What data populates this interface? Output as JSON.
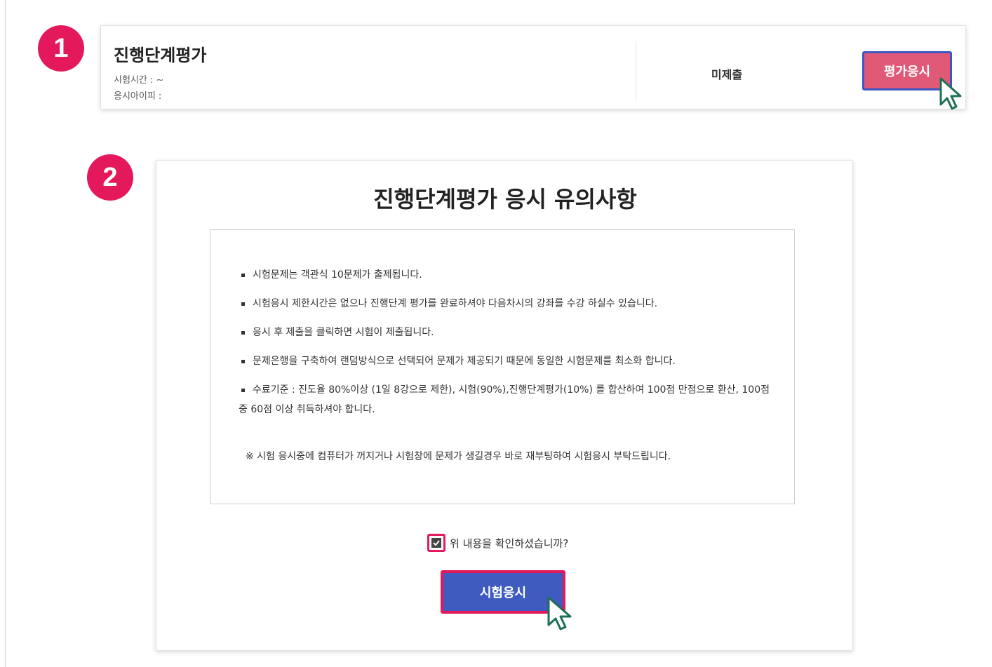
{
  "steps": {
    "one": "1",
    "two": "2"
  },
  "exam_card": {
    "title": "진행단계평가",
    "time_label": "시험시간 : ~",
    "ip_label": "응시아이피 :",
    "status": "미제출",
    "eval_button": "평가응시"
  },
  "notice": {
    "title": "진행단계평가 응시 유의사항",
    "items": [
      "시험문제는 객관식 10문제가 출제됩니다.",
      "시험응시 제한시간은 없으나 진행단계 평가를 완료하셔야 다음차시의 강좌를 수강 하실수 있습니다.",
      "응시 후 제출을 클릭하면 시험이 제출됩니다.",
      "문제은행을 구축하여 랜덤방식으로 선택되어 문제가 제공되기 때문에 동일한 시험문제를 최소화 합니다.",
      "수료기준 : 진도율 80%이상 (1일 8강으로 제한), 시험(90%),진행단계평가(10%) 를 합산하여 100점 만점으로 환산, 100점 중 60점 이상 취득하셔야 합니다."
    ],
    "footnote": "※ 시험 응시중에 컴퓨터가 꺼지거나 시험창에 문제가 생길경우 바로 재부팅하여 시험응시 부탁드립니다.",
    "confirm_label": "위 내용을 확인하셨습니까?",
    "confirm_checked": true,
    "exam_button": "시험응시"
  },
  "colors": {
    "badge": "#e4195c",
    "eval_button": "#e05a78",
    "exam_button": "#3f5bbf",
    "highlight_border": "#e4195c",
    "eval_border": "#3f55c0"
  },
  "icons": {
    "cursor": "pointer-cursor-icon",
    "check": "checkmark-icon"
  }
}
